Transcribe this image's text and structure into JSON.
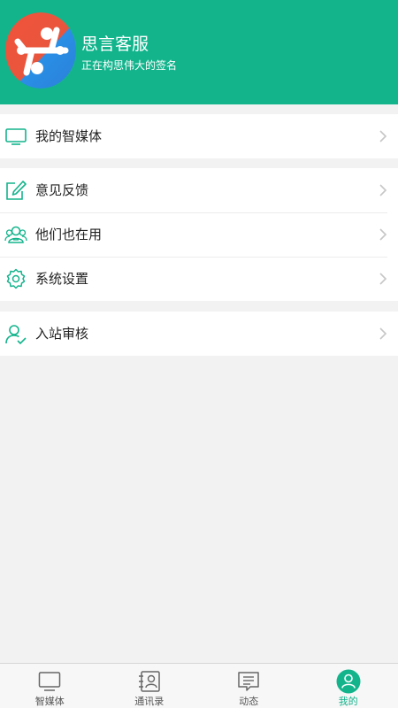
{
  "colors": {
    "accent": "#13b48c",
    "background": "#f2f2f2",
    "row_background": "#ffffff",
    "text": "#222222",
    "chevron": "#c6c6c6",
    "tab_inactive": "#555555"
  },
  "profile": {
    "name": "思言客服",
    "signature": "正在构思伟大的签名",
    "avatar_icon": "node-link-logo-icon"
  },
  "menu": {
    "group1": [
      {
        "label": "我的智媒体",
        "icon": "monitor-icon"
      }
    ],
    "group2": [
      {
        "label": "意见反馈",
        "icon": "edit-note-icon"
      },
      {
        "label": "他们也在用",
        "icon": "users-icon"
      },
      {
        "label": "系统设置",
        "icon": "gear-icon"
      }
    ],
    "group3": [
      {
        "label": "入站审核",
        "icon": "user-check-icon"
      }
    ]
  },
  "tabs": [
    {
      "label": "智媒体",
      "icon": "monitor-icon",
      "active": false
    },
    {
      "label": "通讯录",
      "icon": "contacts-icon",
      "active": false
    },
    {
      "label": "动态",
      "icon": "message-icon",
      "active": false
    },
    {
      "label": "我的",
      "icon": "profile-icon",
      "active": true
    }
  ]
}
